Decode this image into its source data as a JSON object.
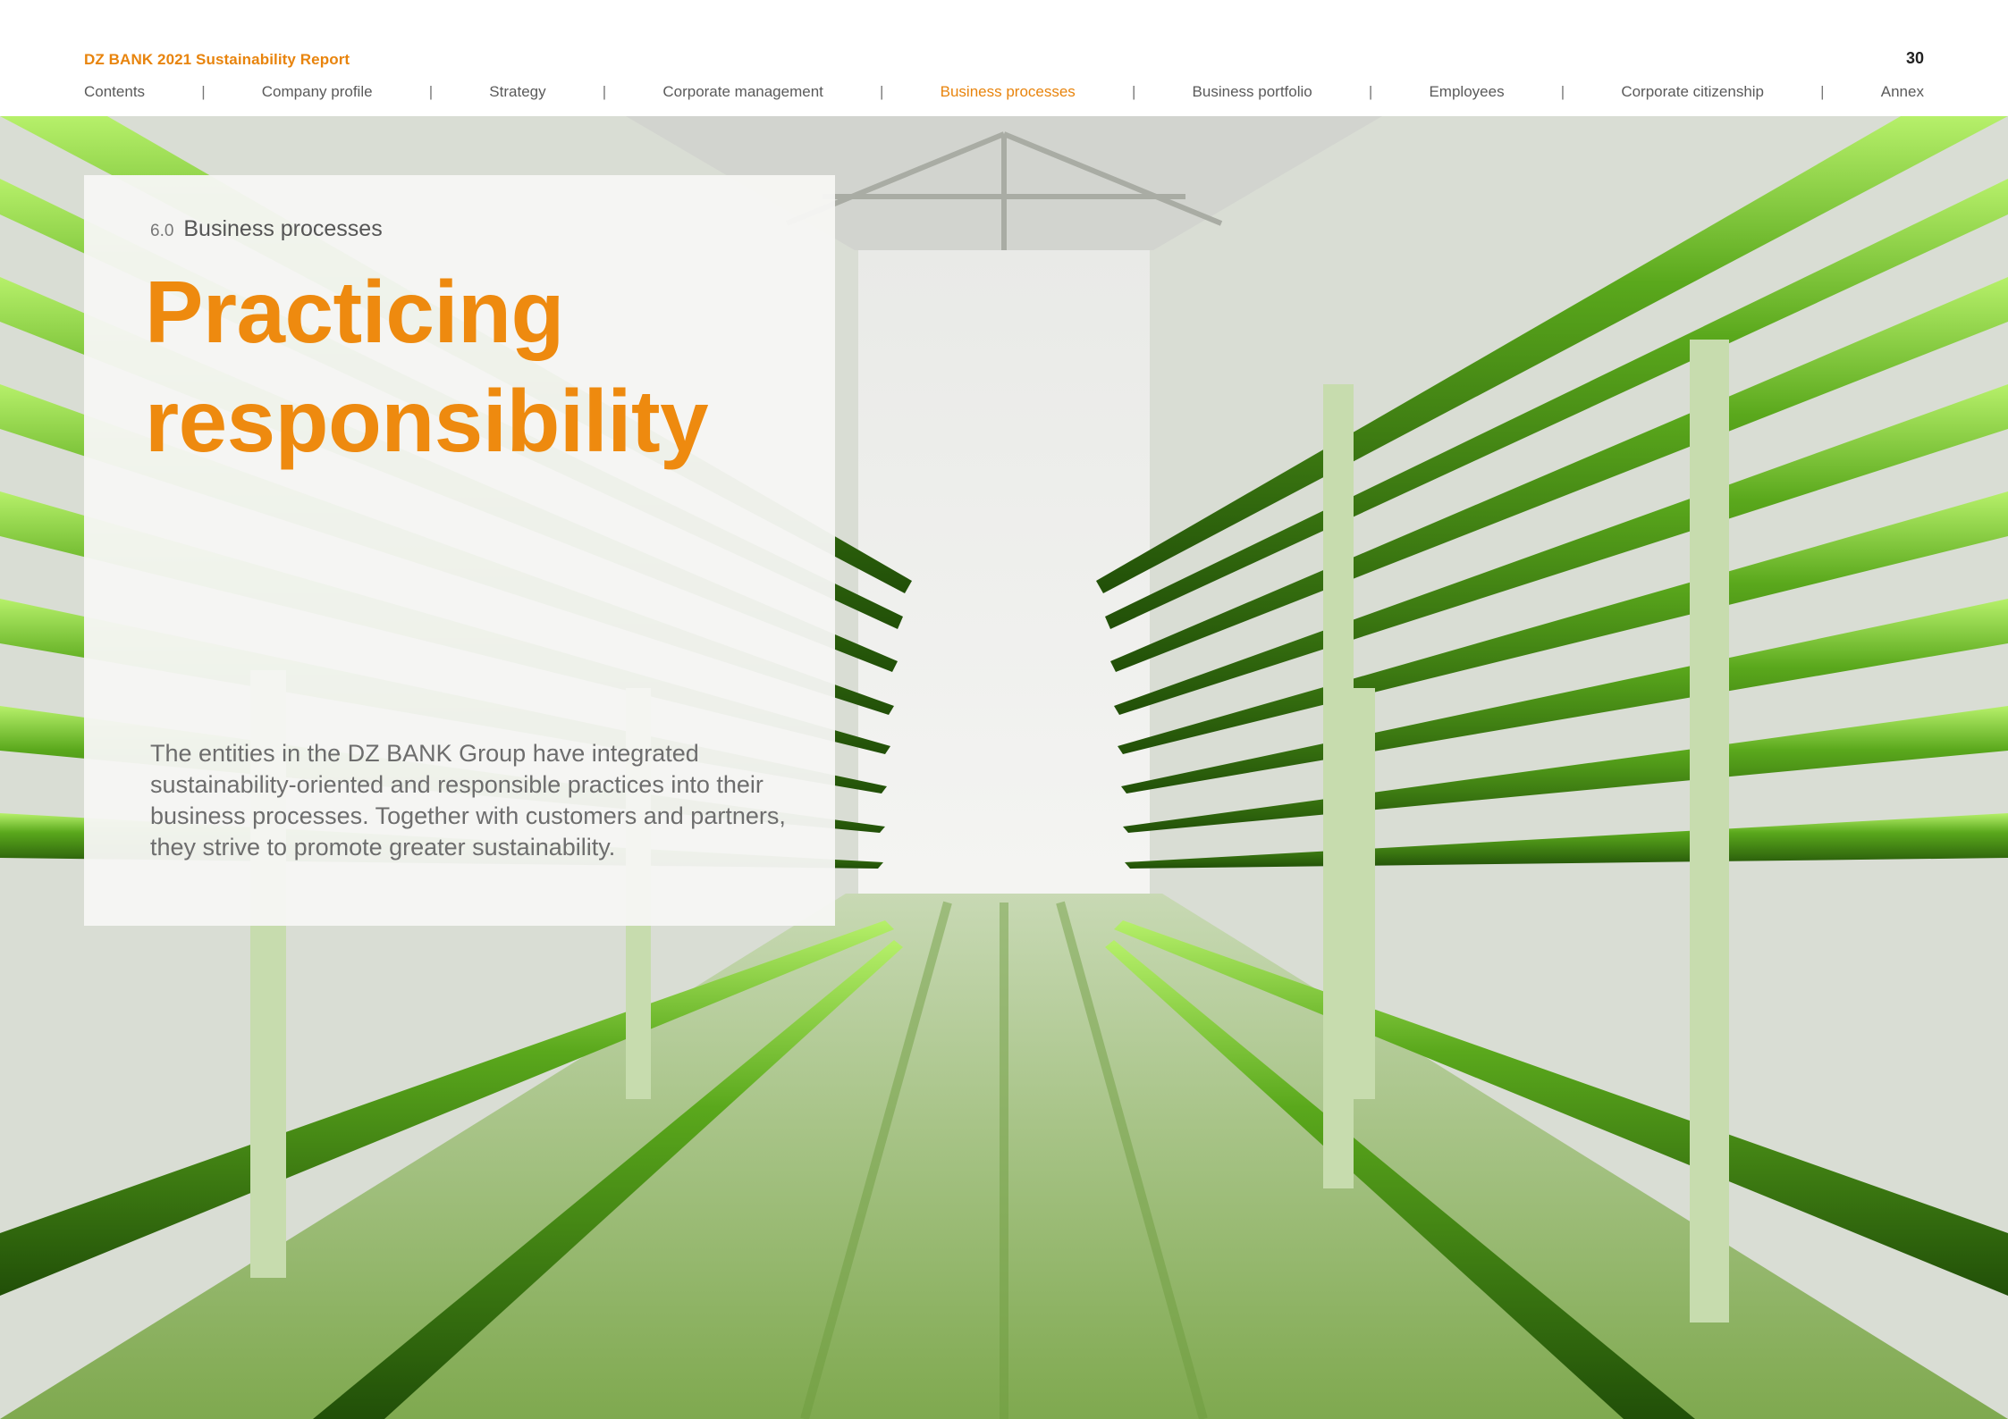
{
  "header": {
    "report_title": "DZ BANK 2021 Sustainability Report",
    "page_number": "30",
    "nav": [
      {
        "label": "Contents",
        "active": false
      },
      {
        "label": "Company profile",
        "active": false
      },
      {
        "label": "Strategy",
        "active": false
      },
      {
        "label": "Corporate management",
        "active": false
      },
      {
        "label": "Business processes",
        "active": true
      },
      {
        "label": "Business portfolio",
        "active": false
      },
      {
        "label": "Employees",
        "active": false
      },
      {
        "label": "Corporate citizenship",
        "active": false
      },
      {
        "label": "Annex",
        "active": false
      }
    ],
    "separator": "|"
  },
  "panel": {
    "section_number": "6.0",
    "section_title": "Business processes",
    "headline_line1": "Practicing",
    "headline_line2": "responsibility",
    "intro": "The entities in the DZ BANK Group have integrated sustainability-oriented and responsible practices into their business processes. Together with customers and partners, they strive to promote greater sustainability."
  },
  "colors": {
    "accent": "#ee8a0f",
    "nav_text": "#5a5a5a",
    "tube_green": "#3f8c12",
    "floor_green": "#8bb35a"
  }
}
